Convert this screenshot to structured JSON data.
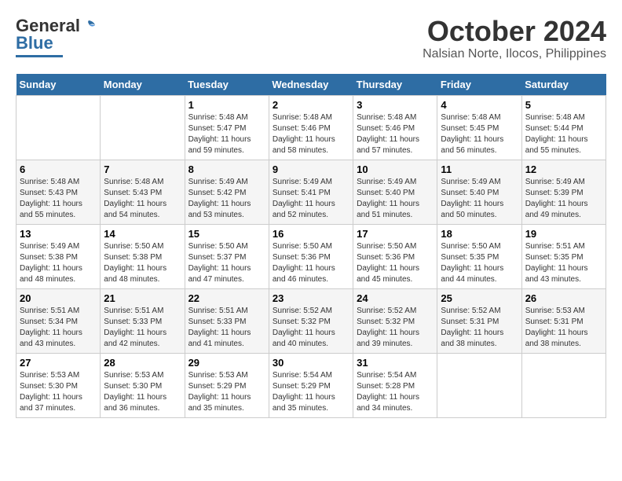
{
  "header": {
    "logo_general": "General",
    "logo_blue": "Blue",
    "month": "October 2024",
    "location": "Nalsian Norte, Ilocos, Philippines"
  },
  "weekdays": [
    "Sunday",
    "Monday",
    "Tuesday",
    "Wednesday",
    "Thursday",
    "Friday",
    "Saturday"
  ],
  "weeks": [
    [
      {
        "day": "",
        "sunrise": "",
        "sunset": "",
        "daylight": ""
      },
      {
        "day": "",
        "sunrise": "",
        "sunset": "",
        "daylight": ""
      },
      {
        "day": "1",
        "sunrise": "Sunrise: 5:48 AM",
        "sunset": "Sunset: 5:47 PM",
        "daylight": "Daylight: 11 hours and 59 minutes."
      },
      {
        "day": "2",
        "sunrise": "Sunrise: 5:48 AM",
        "sunset": "Sunset: 5:46 PM",
        "daylight": "Daylight: 11 hours and 58 minutes."
      },
      {
        "day": "3",
        "sunrise": "Sunrise: 5:48 AM",
        "sunset": "Sunset: 5:46 PM",
        "daylight": "Daylight: 11 hours and 57 minutes."
      },
      {
        "day": "4",
        "sunrise": "Sunrise: 5:48 AM",
        "sunset": "Sunset: 5:45 PM",
        "daylight": "Daylight: 11 hours and 56 minutes."
      },
      {
        "day": "5",
        "sunrise": "Sunrise: 5:48 AM",
        "sunset": "Sunset: 5:44 PM",
        "daylight": "Daylight: 11 hours and 55 minutes."
      }
    ],
    [
      {
        "day": "6",
        "sunrise": "Sunrise: 5:48 AM",
        "sunset": "Sunset: 5:43 PM",
        "daylight": "Daylight: 11 hours and 55 minutes."
      },
      {
        "day": "7",
        "sunrise": "Sunrise: 5:48 AM",
        "sunset": "Sunset: 5:43 PM",
        "daylight": "Daylight: 11 hours and 54 minutes."
      },
      {
        "day": "8",
        "sunrise": "Sunrise: 5:49 AM",
        "sunset": "Sunset: 5:42 PM",
        "daylight": "Daylight: 11 hours and 53 minutes."
      },
      {
        "day": "9",
        "sunrise": "Sunrise: 5:49 AM",
        "sunset": "Sunset: 5:41 PM",
        "daylight": "Daylight: 11 hours and 52 minutes."
      },
      {
        "day": "10",
        "sunrise": "Sunrise: 5:49 AM",
        "sunset": "Sunset: 5:40 PM",
        "daylight": "Daylight: 11 hours and 51 minutes."
      },
      {
        "day": "11",
        "sunrise": "Sunrise: 5:49 AM",
        "sunset": "Sunset: 5:40 PM",
        "daylight": "Daylight: 11 hours and 50 minutes."
      },
      {
        "day": "12",
        "sunrise": "Sunrise: 5:49 AM",
        "sunset": "Sunset: 5:39 PM",
        "daylight": "Daylight: 11 hours and 49 minutes."
      }
    ],
    [
      {
        "day": "13",
        "sunrise": "Sunrise: 5:49 AM",
        "sunset": "Sunset: 5:38 PM",
        "daylight": "Daylight: 11 hours and 48 minutes."
      },
      {
        "day": "14",
        "sunrise": "Sunrise: 5:50 AM",
        "sunset": "Sunset: 5:38 PM",
        "daylight": "Daylight: 11 hours and 48 minutes."
      },
      {
        "day": "15",
        "sunrise": "Sunrise: 5:50 AM",
        "sunset": "Sunset: 5:37 PM",
        "daylight": "Daylight: 11 hours and 47 minutes."
      },
      {
        "day": "16",
        "sunrise": "Sunrise: 5:50 AM",
        "sunset": "Sunset: 5:36 PM",
        "daylight": "Daylight: 11 hours and 46 minutes."
      },
      {
        "day": "17",
        "sunrise": "Sunrise: 5:50 AM",
        "sunset": "Sunset: 5:36 PM",
        "daylight": "Daylight: 11 hours and 45 minutes."
      },
      {
        "day": "18",
        "sunrise": "Sunrise: 5:50 AM",
        "sunset": "Sunset: 5:35 PM",
        "daylight": "Daylight: 11 hours and 44 minutes."
      },
      {
        "day": "19",
        "sunrise": "Sunrise: 5:51 AM",
        "sunset": "Sunset: 5:35 PM",
        "daylight": "Daylight: 11 hours and 43 minutes."
      }
    ],
    [
      {
        "day": "20",
        "sunrise": "Sunrise: 5:51 AM",
        "sunset": "Sunset: 5:34 PM",
        "daylight": "Daylight: 11 hours and 43 minutes."
      },
      {
        "day": "21",
        "sunrise": "Sunrise: 5:51 AM",
        "sunset": "Sunset: 5:33 PM",
        "daylight": "Daylight: 11 hours and 42 minutes."
      },
      {
        "day": "22",
        "sunrise": "Sunrise: 5:51 AM",
        "sunset": "Sunset: 5:33 PM",
        "daylight": "Daylight: 11 hours and 41 minutes."
      },
      {
        "day": "23",
        "sunrise": "Sunrise: 5:52 AM",
        "sunset": "Sunset: 5:32 PM",
        "daylight": "Daylight: 11 hours and 40 minutes."
      },
      {
        "day": "24",
        "sunrise": "Sunrise: 5:52 AM",
        "sunset": "Sunset: 5:32 PM",
        "daylight": "Daylight: 11 hours and 39 minutes."
      },
      {
        "day": "25",
        "sunrise": "Sunrise: 5:52 AM",
        "sunset": "Sunset: 5:31 PM",
        "daylight": "Daylight: 11 hours and 38 minutes."
      },
      {
        "day": "26",
        "sunrise": "Sunrise: 5:53 AM",
        "sunset": "Sunset: 5:31 PM",
        "daylight": "Daylight: 11 hours and 38 minutes."
      }
    ],
    [
      {
        "day": "27",
        "sunrise": "Sunrise: 5:53 AM",
        "sunset": "Sunset: 5:30 PM",
        "daylight": "Daylight: 11 hours and 37 minutes."
      },
      {
        "day": "28",
        "sunrise": "Sunrise: 5:53 AM",
        "sunset": "Sunset: 5:30 PM",
        "daylight": "Daylight: 11 hours and 36 minutes."
      },
      {
        "day": "29",
        "sunrise": "Sunrise: 5:53 AM",
        "sunset": "Sunset: 5:29 PM",
        "daylight": "Daylight: 11 hours and 35 minutes."
      },
      {
        "day": "30",
        "sunrise": "Sunrise: 5:54 AM",
        "sunset": "Sunset: 5:29 PM",
        "daylight": "Daylight: 11 hours and 35 minutes."
      },
      {
        "day": "31",
        "sunrise": "Sunrise: 5:54 AM",
        "sunset": "Sunset: 5:28 PM",
        "daylight": "Daylight: 11 hours and 34 minutes."
      },
      {
        "day": "",
        "sunrise": "",
        "sunset": "",
        "daylight": ""
      },
      {
        "day": "",
        "sunrise": "",
        "sunset": "",
        "daylight": ""
      }
    ]
  ]
}
